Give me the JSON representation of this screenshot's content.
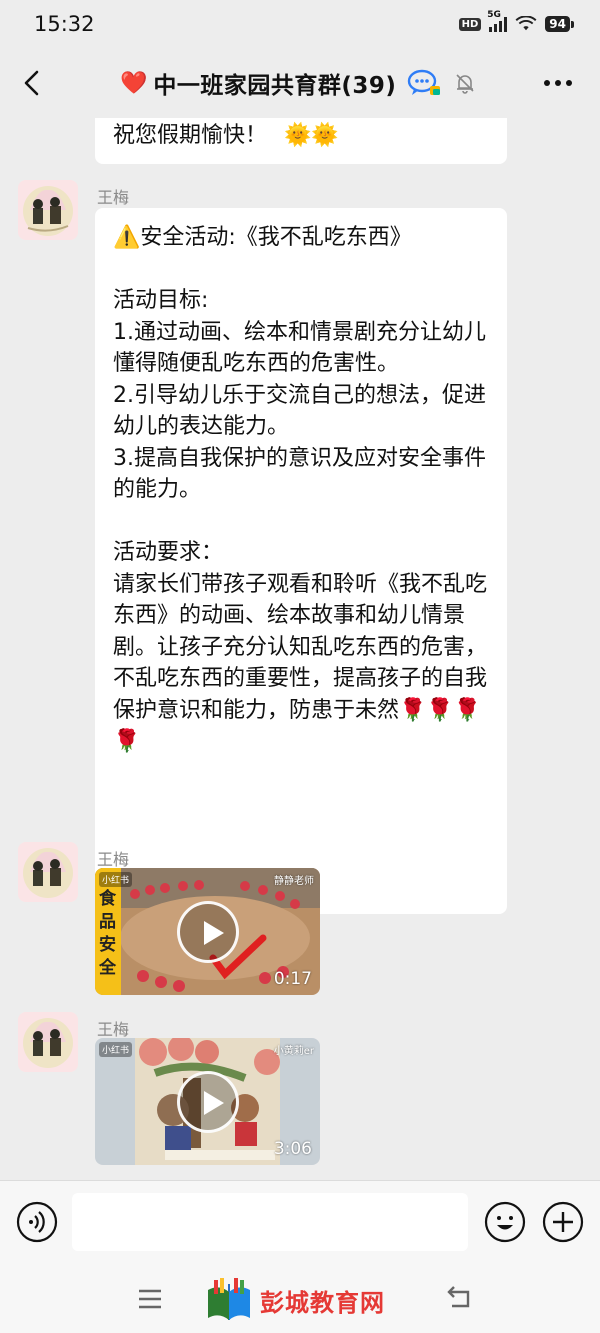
{
  "status_bar": {
    "time": "15:32",
    "hd_label": "HD",
    "network_label": "5G",
    "battery": "94"
  },
  "header": {
    "title_emoji": "❤️",
    "title": "中一班家园共育群(39)",
    "icons": [
      "back-arrow",
      "chat-badge",
      "mute-bell",
      "more-dots"
    ]
  },
  "messages": {
    "prev_message": {
      "text": "祝您假期愉快！",
      "emoji": "🌞🌞"
    },
    "post": {
      "sender": "王梅",
      "text": "⚠️安全活动:《我不乱吃东西》\n\n活动目标:\n1.通过动画、绘本和情景剧充分让幼儿懂得随便乱吃东西的危害性。\n2.引导幼儿乐于交流自己的想法，促进幼儿的表达能力。\n3.提高自我保护的意识及应对安全事件的能力。\n\n活动要求：\n请家长们带孩子观看和聆听《我不乱吃东西》的动画、绘本故事和幼儿情景剧。让孩子充分认知乱吃东西的危害，不乱吃东西的重要性，提高孩子的自我保护意识和能力，防患于未然🌹🌹🌹🌹"
    },
    "video1": {
      "sender": "王梅",
      "duration": "0:17",
      "corner_tag": "小红书",
      "side_title": "食品安全",
      "author_tag": "静静老师"
    },
    "video2": {
      "sender": "王梅",
      "duration": "3:06",
      "corner_tag": "小红书",
      "author_tag": "小黄莉er"
    }
  },
  "input_bar": {
    "placeholder": "",
    "icons": [
      "voice",
      "emoji",
      "plus"
    ]
  },
  "nav_bar": {
    "watermark": "彭城教育网",
    "icons": [
      "menu",
      "back"
    ]
  },
  "colors": {
    "background": "#ededed",
    "bubble": "#ffffff",
    "sender_name": "#8a8a8a",
    "watermark_red": "#e53935"
  }
}
